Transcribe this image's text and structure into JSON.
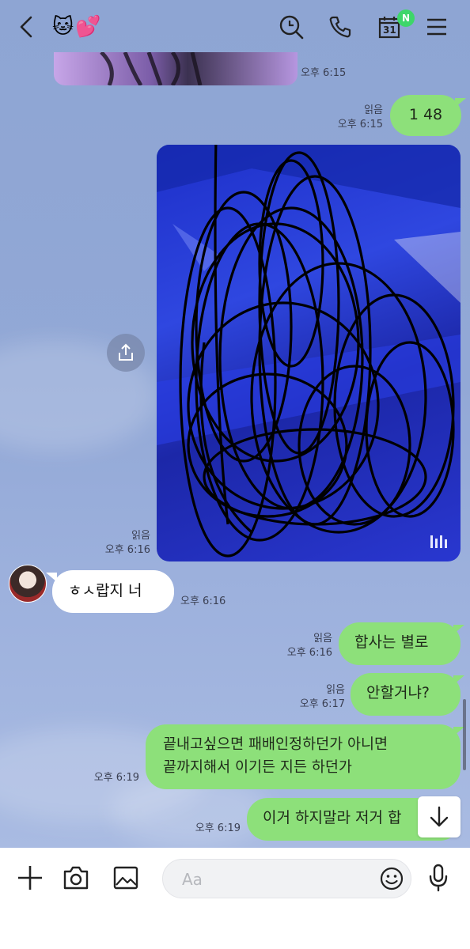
{
  "header": {
    "back_icon": "chevron-left-icon",
    "title_emojis": [
      "🐱",
      "💕"
    ],
    "search_icon": "search-icon",
    "call_icon": "phone-icon",
    "calendar_day": "31",
    "calendar_badge": "N",
    "menu_icon": "menu-icon"
  },
  "messages": [
    {
      "id": "m0",
      "side": "me",
      "kind": "photo",
      "time": "오후 6:15"
    },
    {
      "id": "m1",
      "side": "me",
      "kind": "text",
      "text": "1 48",
      "read": "읽음",
      "time": "오후 6:15"
    },
    {
      "id": "m2",
      "side": "me",
      "kind": "video",
      "read": "읽음",
      "time": "오후 6:16"
    },
    {
      "id": "m3",
      "side": "them",
      "kind": "text",
      "text": "ㅎㅅ랍지 너",
      "time": "오후 6:16"
    },
    {
      "id": "m4",
      "side": "me",
      "kind": "text",
      "text": "합사는 별로",
      "read": "읽음",
      "time": "오후 6:16"
    },
    {
      "id": "m5",
      "side": "me",
      "kind": "text",
      "text": "안할거냐?",
      "read": "읽음",
      "time": "오후 6:17"
    },
    {
      "id": "m6",
      "side": "me",
      "kind": "text",
      "text_line1": "끝내고싶으면 패배인정하던가 아니면",
      "text_line2": "끝까지해서 이기든 지든 하던가",
      "time": "오후 6:19"
    },
    {
      "id": "m7",
      "side": "me",
      "kind": "text",
      "text": "이거 하지말라 저거 합",
      "time": "오후 6:19"
    }
  ],
  "composer": {
    "placeholder": "Aa",
    "icons": [
      "plus-icon",
      "camera-icon",
      "image-icon",
      "emoji-icon",
      "microphone-icon"
    ]
  },
  "colors": {
    "chat_background": "#8fa6d4",
    "my_bubble": "#8de07a",
    "their_bubble": "#ffffff",
    "badge_green": "#3ed66a"
  }
}
